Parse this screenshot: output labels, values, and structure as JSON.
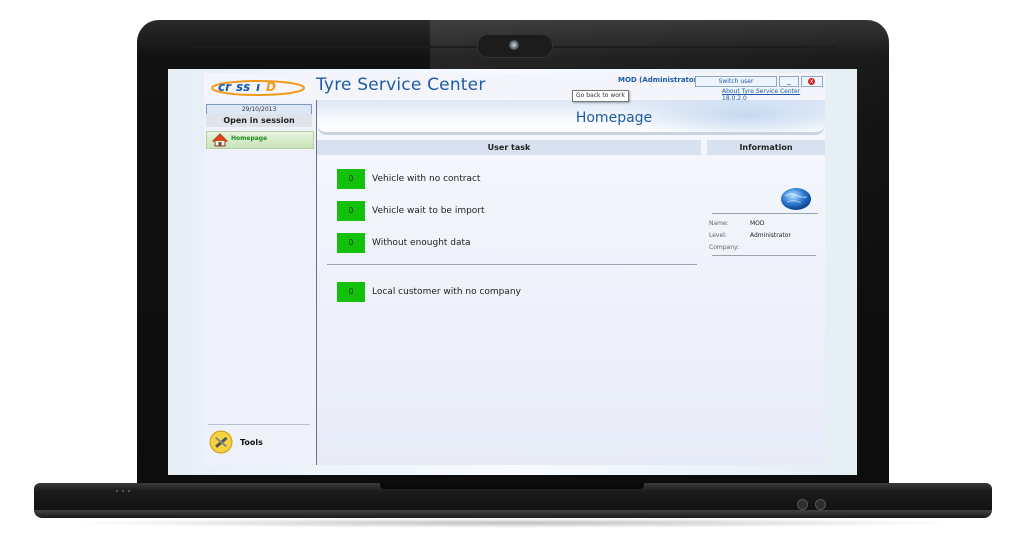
{
  "app": {
    "title": "Tyre Service Center",
    "user_label": "MOD (Administrator)",
    "switch_user": "Switch user",
    "minimize": "_",
    "close": "x",
    "about_link": "About Tyre Service Center 18.0.2.0",
    "tooltip": "Go back to work"
  },
  "sidebar": {
    "date": "29/10/2013",
    "session": "Open in session",
    "nav_home": "Homepage",
    "tools": "Tools"
  },
  "main": {
    "page_title": "Homepage",
    "user_task_header": "User task",
    "information_header": "Information",
    "tasks": [
      {
        "count": "0",
        "label": "Vehicle with no contract"
      },
      {
        "count": "0",
        "label": "Vehicle wait to be import"
      },
      {
        "count": "0",
        "label": "Without enought data"
      },
      {
        "count": "0",
        "label": "Local customer with no company"
      }
    ]
  },
  "info": {
    "name_key": "Name:",
    "name_value": "MOD",
    "level_key": "Level:",
    "level_value": "Administrator",
    "company_key": "Company:",
    "company_value": ""
  },
  "colors": {
    "accent": "#1e5aa8",
    "task_badge": "#13c10b",
    "close_red": "#d32121"
  }
}
